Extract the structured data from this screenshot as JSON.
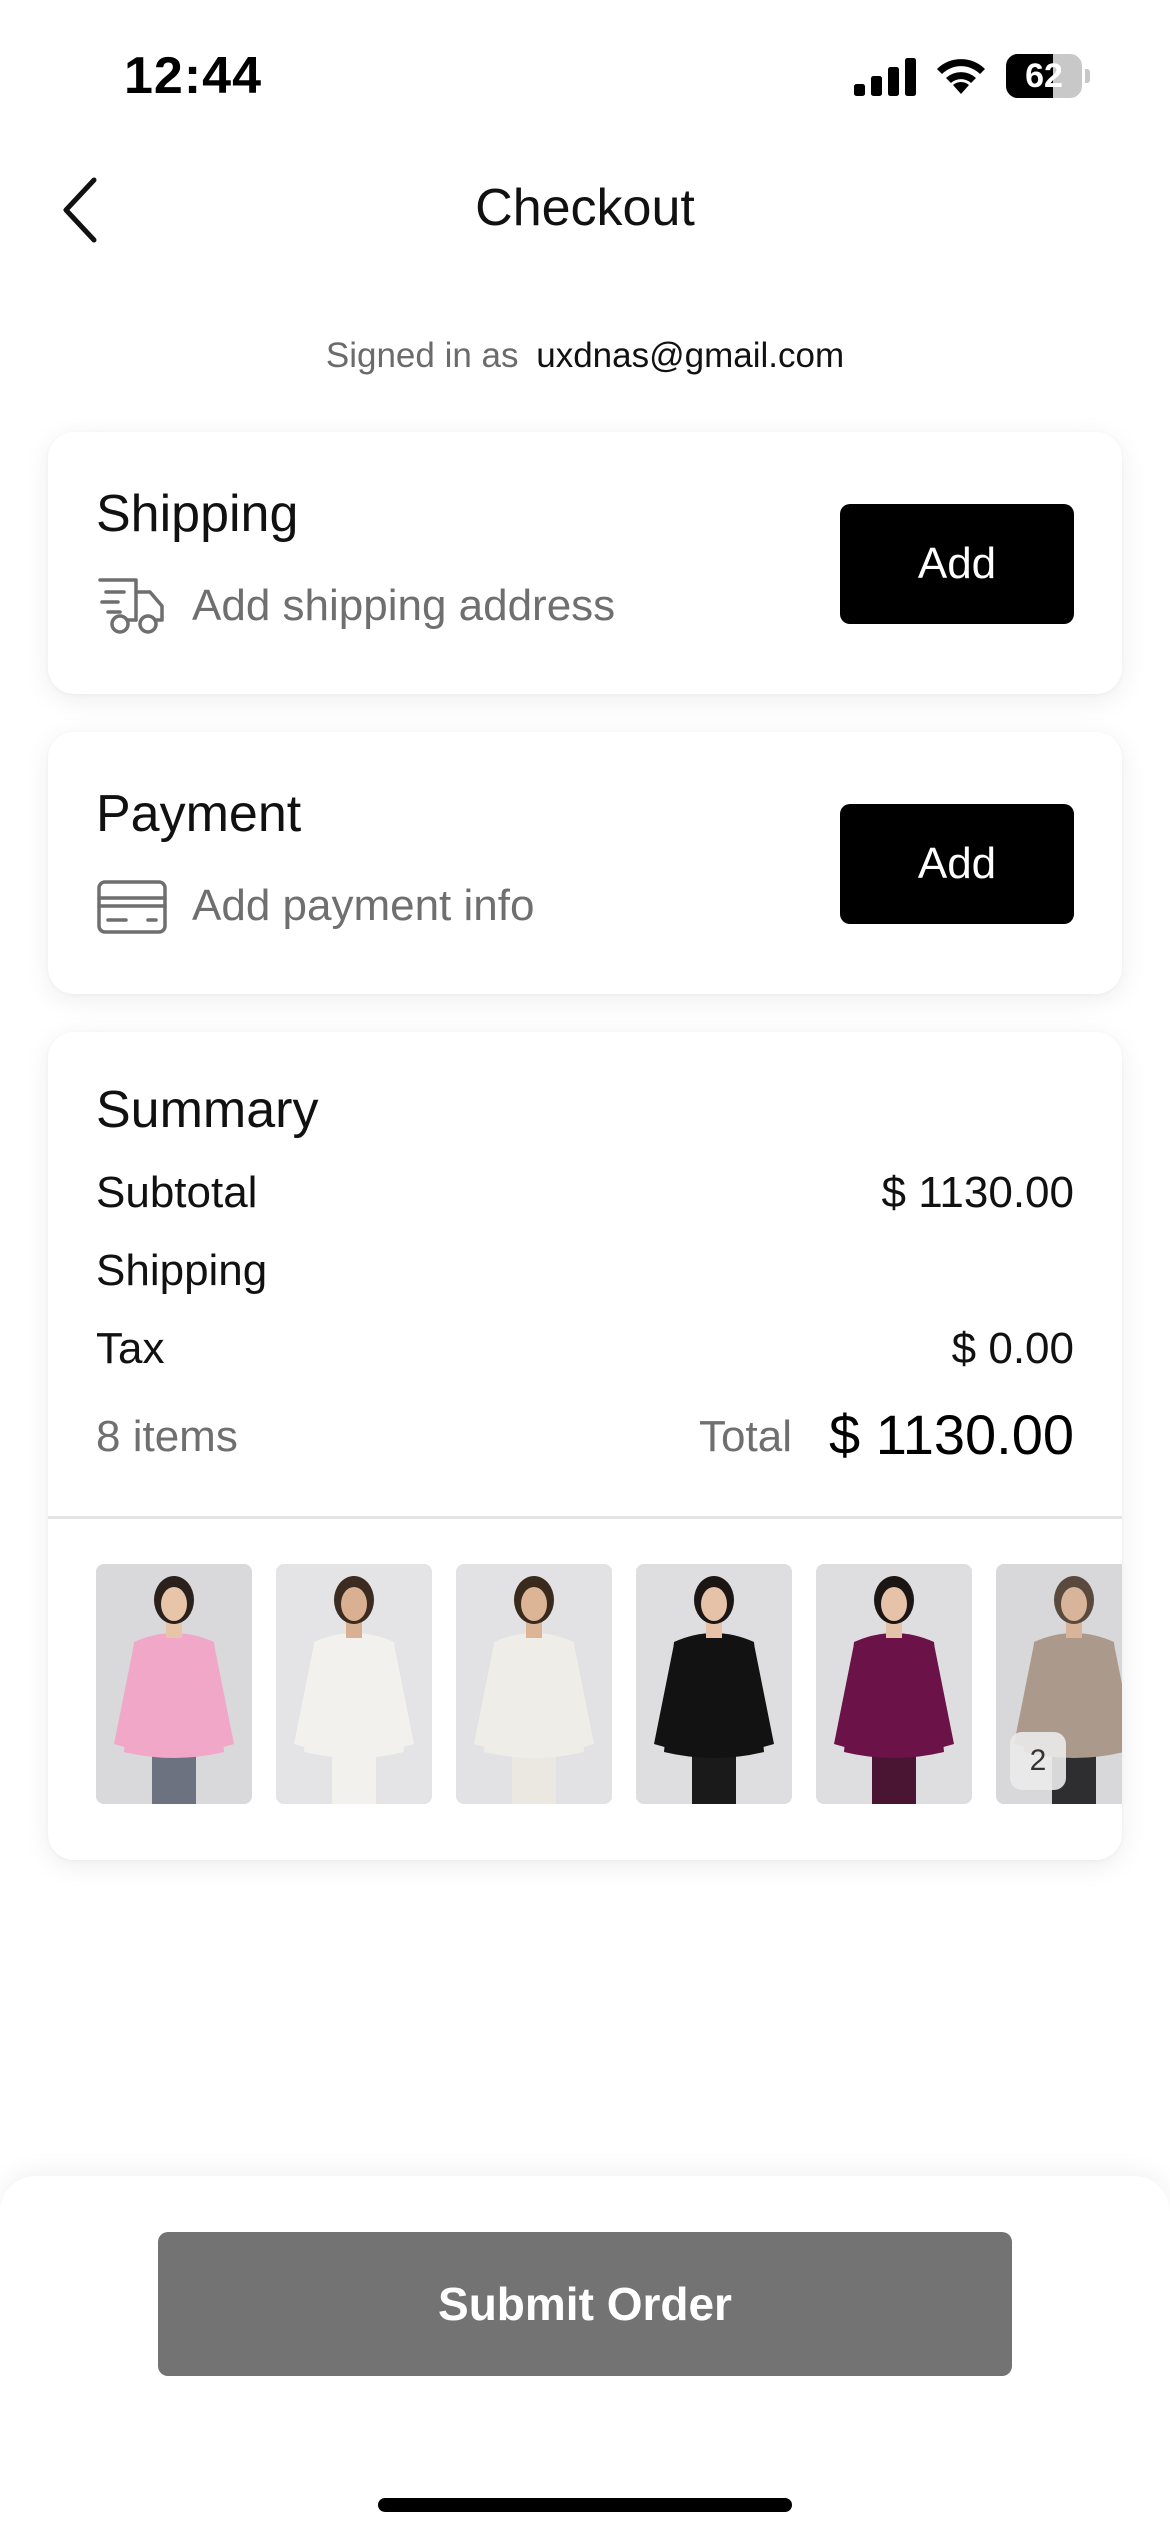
{
  "status_bar": {
    "time": "12:44",
    "battery_level": "62",
    "battery_fraction": 0.62,
    "icons": [
      "signal-icon",
      "wifi-icon",
      "battery-icon"
    ]
  },
  "nav": {
    "title": "Checkout",
    "back_icon": "chevron-left-icon"
  },
  "account": {
    "label": "Signed in as",
    "email": "uxdnas@gmail.com"
  },
  "shipping": {
    "title": "Shipping",
    "subtitle": "Add shipping address",
    "icon": "delivery-truck-icon",
    "button_label": "Add"
  },
  "payment": {
    "title": "Payment",
    "subtitle": "Add payment info",
    "icon": "credit-card-icon",
    "button_label": "Add"
  },
  "summary": {
    "title": "Summary",
    "subtotal_label": "Subtotal",
    "subtotal_value": "$ 1130.00",
    "shipping_label": "Shipping",
    "shipping_value": "",
    "tax_label": "Tax",
    "tax_value": "$ 0.00",
    "items_count": "8 items",
    "total_label": "Total",
    "total_value": "$ 1130.00"
  },
  "products": [
    {
      "name": "pink-sweater",
      "colors": {
        "bg": "#d9d9dc",
        "garment": "#f0a7c8",
        "bottom": "#6d7280",
        "hair": "#2a211c",
        "skin": "#e8c4a8"
      }
    },
    {
      "name": "white-dress",
      "colors": {
        "bg": "#e4e4e7",
        "garment": "#f2f1ed",
        "bottom": "#f2f1ed",
        "hair": "#3b2b20",
        "skin": "#d9b092"
      }
    },
    {
      "name": "white-shirt-shorts",
      "colors": {
        "bg": "#e2e2e4",
        "garment": "#efede8",
        "bottom": "#ebe8e2",
        "hair": "#3a2a1e",
        "skin": "#dcb496"
      }
    },
    {
      "name": "black-off-shoulder-sweater",
      "colors": {
        "bg": "#dedee0",
        "garment": "#121212",
        "bottom": "#1a1a1a",
        "hair": "#1b1614",
        "skin": "#e6c3a8"
      }
    },
    {
      "name": "purple-off-shoulder-sweater",
      "colors": {
        "bg": "#dedee0",
        "garment": "#6b1249",
        "bottom": "#4a1433",
        "hair": "#1b1614",
        "skin": "#e6c3a8"
      }
    },
    {
      "name": "taupe-draped-top",
      "colors": {
        "bg": "#d8d8da",
        "garment": "#ab9a8c",
        "bottom": "#2e2e30",
        "hair": "#5a4a3e",
        "skin": "#d8b59a"
      },
      "badge": "2"
    }
  ],
  "footer": {
    "submit_label": "Submit Order"
  }
}
